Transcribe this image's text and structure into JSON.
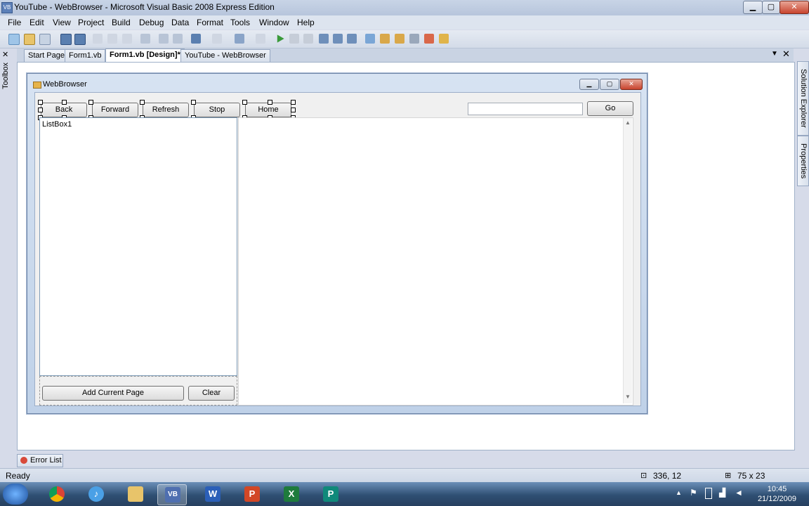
{
  "window": {
    "title": "YouTube - WebBrowser - Microsoft Visual Basic 2008 Express Edition",
    "app_icon": "VB"
  },
  "menu": [
    "File",
    "Edit",
    "View",
    "Project",
    "Build",
    "Debug",
    "Data",
    "Format",
    "Tools",
    "Window",
    "Help"
  ],
  "doc_tabs": [
    "Start Page",
    "Form1.vb",
    "Form1.vb [Design]*",
    "YouTube - WebBrowser"
  ],
  "active_tab_index": 2,
  "side_panels": {
    "left": "Toolbox",
    "right_top": "Solution Explorer",
    "right_bottom": "Properties"
  },
  "form": {
    "title": "WebBrowser",
    "nav_buttons": [
      "Back",
      "Forward",
      "Refresh",
      "Stop",
      "Home"
    ],
    "url_value": "",
    "go_button": "Go",
    "listbox_label": "ListBox1",
    "add_button": "Add Current Page",
    "clear_button": "Clear"
  },
  "bottom_tab": "Error List",
  "status": {
    "text": "Ready",
    "position": "336, 12",
    "size": "75 x 23"
  },
  "taskbar": {
    "apps": [
      "windows-start",
      "chrome",
      "itunes",
      "explorer",
      "visual-basic",
      "word",
      "powerpoint",
      "excel",
      "publisher"
    ],
    "time": "10:45",
    "date": "21/12/2009"
  },
  "colors": {
    "chrome_blue": "#5b7fb8",
    "taskbar": "#2f4f73"
  }
}
